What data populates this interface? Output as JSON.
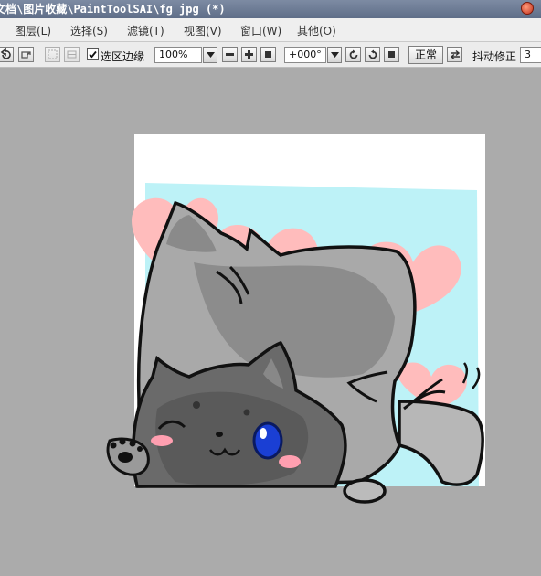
{
  "titlebar": {
    "title": "文档\\图片收藏\\PaintToolSAI\\fg jpg (*)"
  },
  "menu": {
    "items": [
      {
        "label": "图层(L)"
      },
      {
        "label": "选择(S)"
      },
      {
        "label": "滤镜(T)"
      },
      {
        "label": "视图(V)"
      },
      {
        "label": "窗口(W)"
      },
      {
        "label": "其他(O)"
      }
    ]
  },
  "toolbar": {
    "selection_edge_label": "选区边缘",
    "selection_edge_checked": true,
    "zoom_value": "100%",
    "rotation_value": "+000°",
    "blend_mode": "正常",
    "stabilizer_label": "抖动修正",
    "stabilizer_value": "3"
  },
  "colors": {
    "canvas_bg": "#ababab",
    "sky": "#bdf2f7",
    "heart": "#ffbcbc",
    "fur_light": "#a9a9a9",
    "fur_mid": "#8c8c8c",
    "fur_dark": "#555555",
    "eye_blue": "#1a3fd4",
    "blush": "#ff9fb0"
  }
}
